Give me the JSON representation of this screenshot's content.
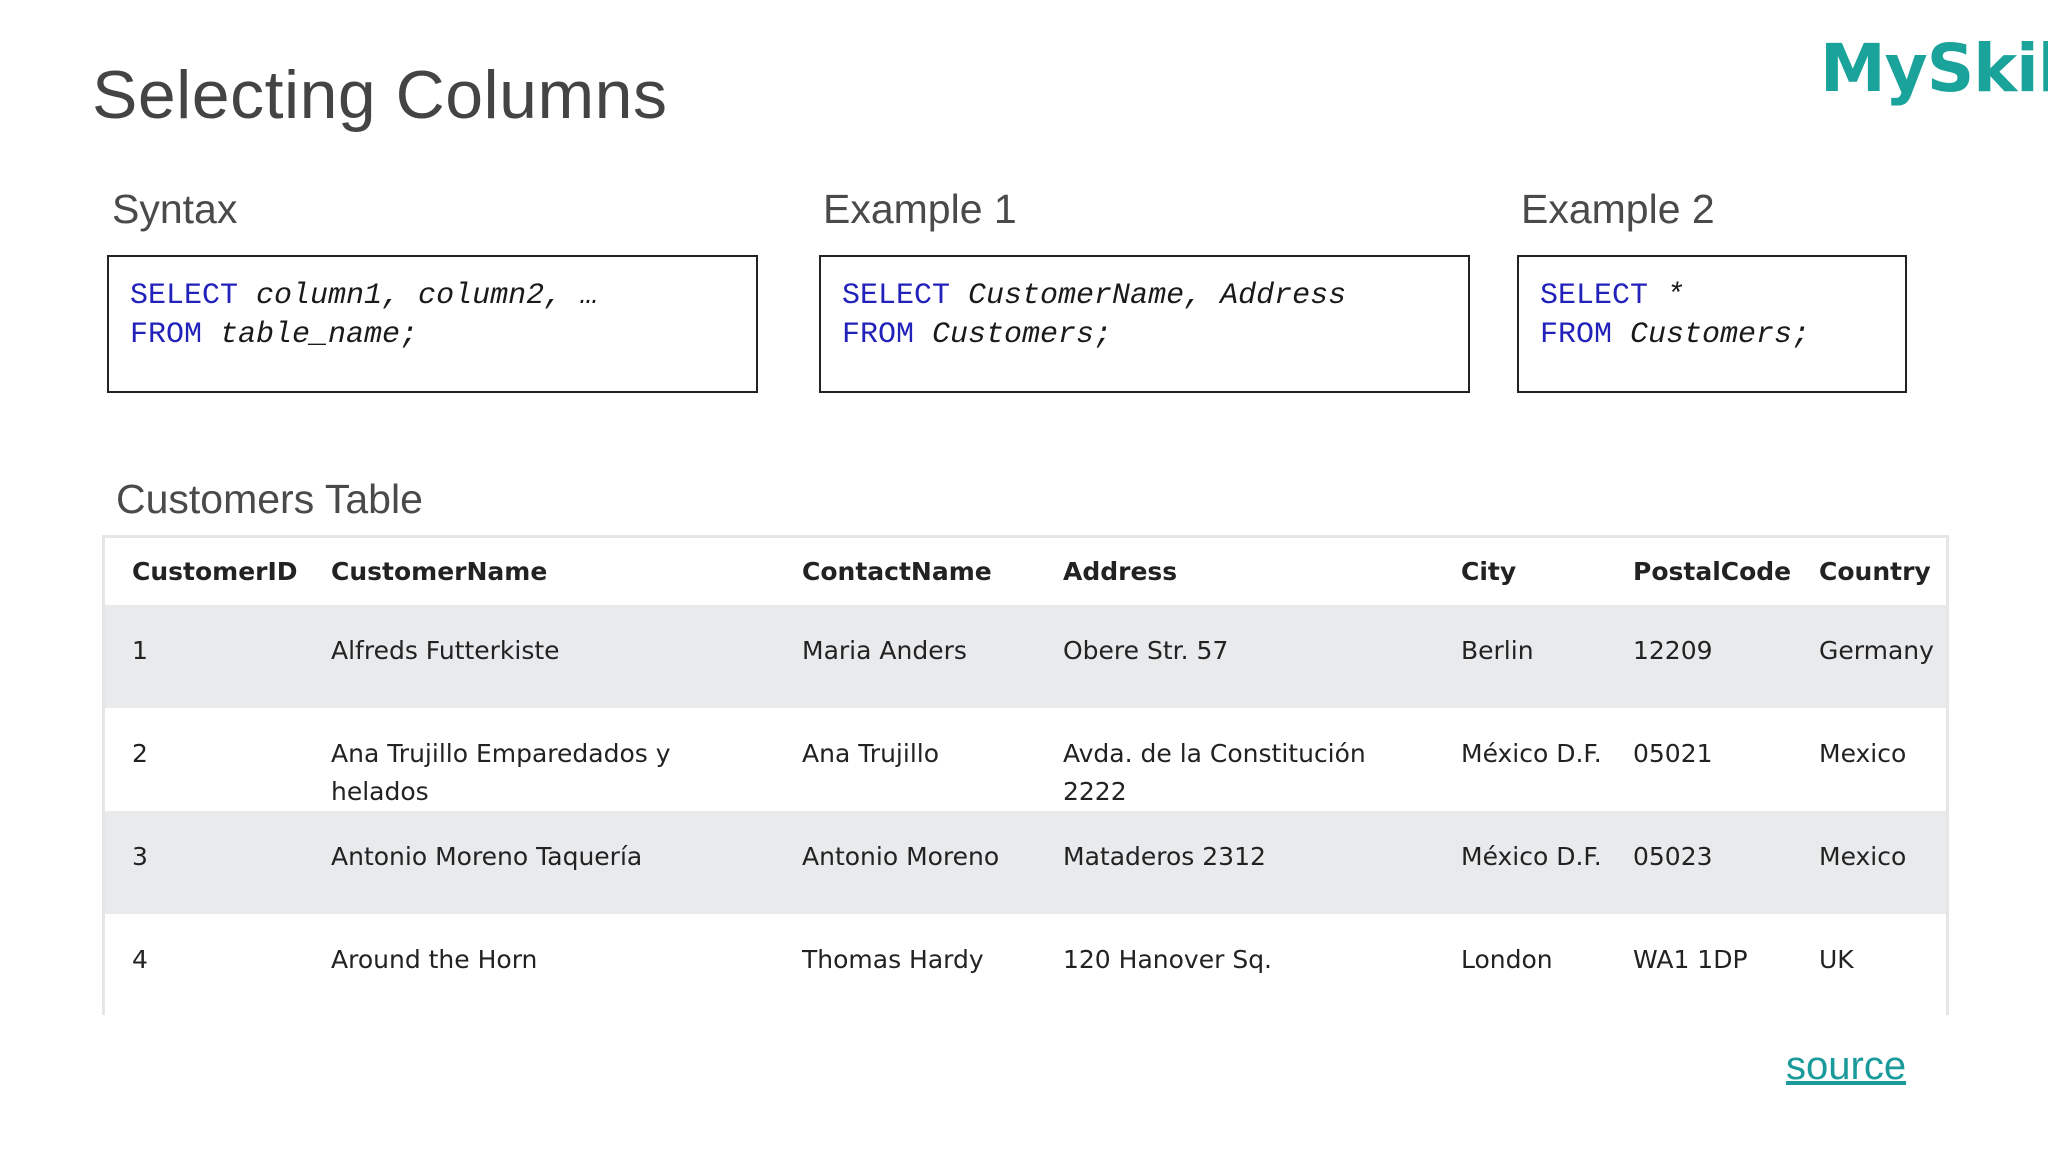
{
  "page": {
    "title": "Selecting Columns",
    "logo": "MySkill",
    "source_link": "source"
  },
  "syntax": {
    "label": "Syntax",
    "line1_kw": "SELECT",
    "line1_rest": " column1, column2, …",
    "line2_kw": "FROM",
    "line2_rest": " table_name;"
  },
  "example1": {
    "label": "Example 1",
    "line1_kw": "SELECT",
    "line1_rest": " CustomerName, Address",
    "line2_kw": "FROM",
    "line2_rest": " Customers;"
  },
  "example2": {
    "label": "Example 2",
    "line1_kw": "SELECT",
    "line1_rest": " *",
    "line2_kw": "FROM",
    "line2_rest": " Customers;"
  },
  "customers_table": {
    "label": "Customers Table",
    "headers": [
      "CustomerID",
      "CustomerName",
      "ContactName",
      "Address",
      "City",
      "PostalCode",
      "Country"
    ],
    "rows": [
      [
        "1",
        "Alfreds Futterkiste",
        "Maria Anders",
        "Obere Str. 57",
        "Berlin",
        "12209",
        "Germany"
      ],
      [
        "2",
        "Ana Trujillo Emparedados y helados",
        "Ana Trujillo",
        "Avda. de la Constitución 2222",
        "México D.F.",
        "05021",
        "Mexico"
      ],
      [
        "3",
        "Antonio Moreno Taquería",
        "Antonio Moreno",
        "Mataderos 2312",
        "México D.F.",
        "05023",
        "Mexico"
      ],
      [
        "4",
        "Around the Horn",
        "Thomas Hardy",
        "120 Hanover Sq.",
        "London",
        "WA1 1DP",
        "UK"
      ]
    ]
  }
}
